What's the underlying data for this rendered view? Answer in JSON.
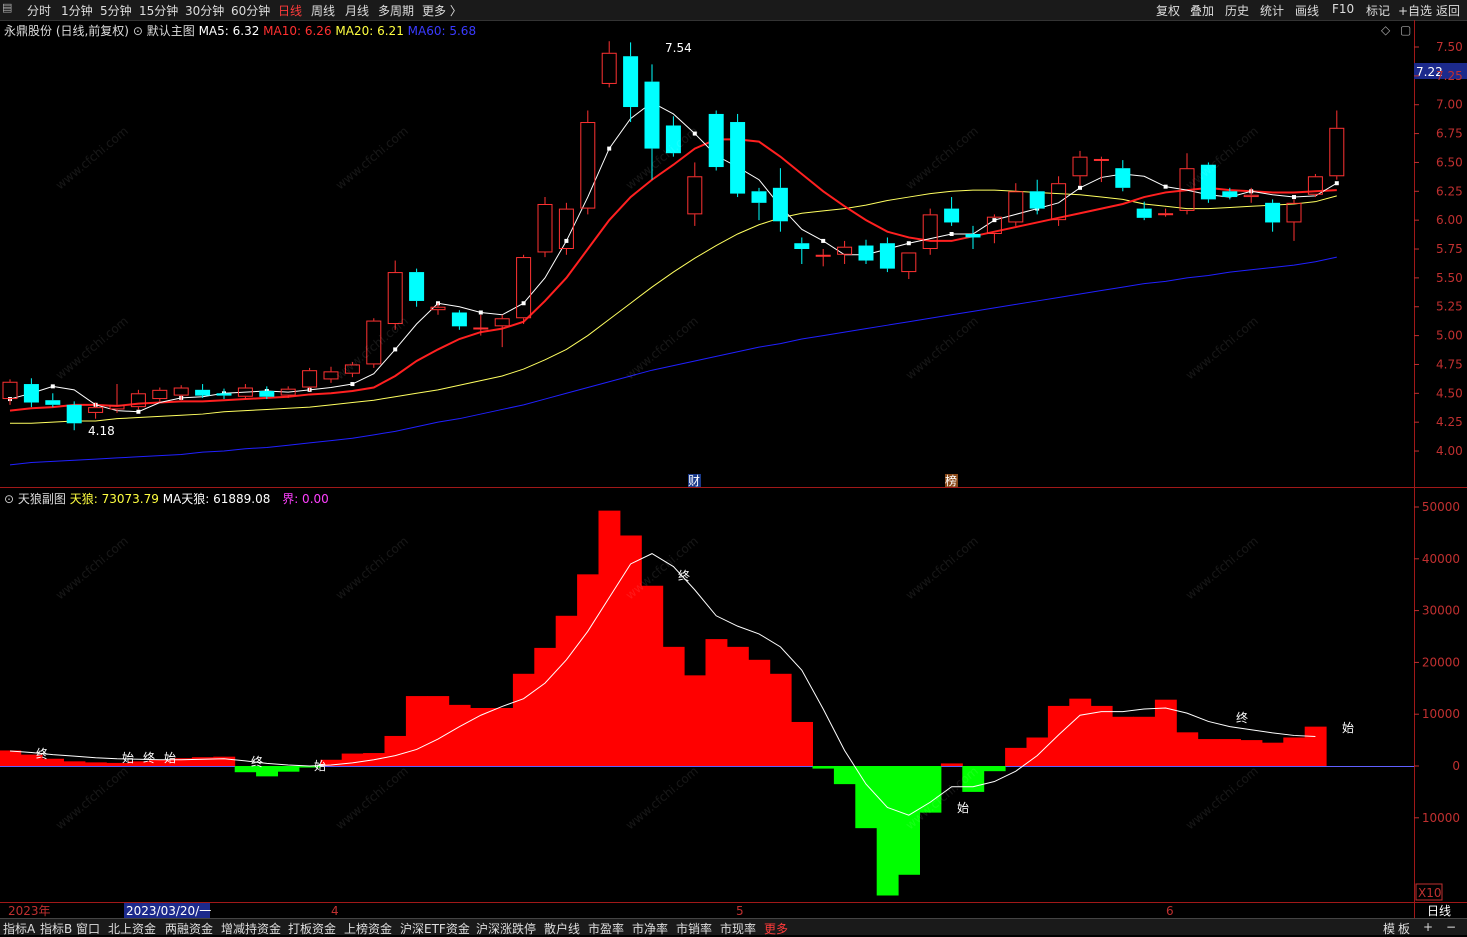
{
  "toolbar": {
    "left": [
      "分时",
      "1分钟",
      "5分钟",
      "15分钟",
      "30分钟",
      "60分钟",
      "日线",
      "周线",
      "月线",
      "多周期",
      "更多 〉"
    ],
    "active": "日线",
    "right": [
      "复权",
      "叠加",
      "历史",
      "统计",
      "画线",
      "F10",
      "标记",
      "+自选",
      "返回"
    ]
  },
  "main_legend": {
    "stock": "永鼎股份 (日线,前复权)",
    "template": "默认主图",
    "ma5": "MA5: 6.32",
    "ma10": "MA10: 6.26",
    "ma20": "MA20: 6.21",
    "ma60": "MA60: 5.68"
  },
  "sub_legend": {
    "name": "天狼副图",
    "tianlang": "天狼: 73073.79",
    "ma_tianlang": "MA天狼: 61889.08",
    "jie": "界: 0.00"
  },
  "colors": {
    "up": "#ff3232",
    "down": "#00ffff",
    "ma5": "#ffffff",
    "ma10": "#ff2020",
    "ma20": "#ffff60",
    "ma60": "#2020ff",
    "pos": "#ff0000",
    "neg": "#00ff00"
  },
  "price_axis": [
    "7.50",
    "7.25",
    "7.00",
    "6.75",
    "6.50",
    "6.25",
    "6.00",
    "5.75",
    "5.50",
    "5.25",
    "5.00",
    "4.75",
    "4.50",
    "4.25",
    "4.00"
  ],
  "current_price": "7.22",
  "annotations": {
    "high": "7.54",
    "low": "4.18",
    "cai": "财",
    "bang": "榜"
  },
  "sub_axis": [
    "50000",
    "40000",
    "30000",
    "20000",
    "10000",
    "0",
    "10000"
  ],
  "sub_labels": [
    "终",
    "始",
    "终",
    "始",
    "终",
    "始",
    "终",
    "始",
    "终",
    "始"
  ],
  "x10": "X10",
  "date_axis": {
    "year": "2023年",
    "date": "2023/03/20/一",
    "months": [
      "4",
      "5",
      "6"
    ],
    "period": "日线"
  },
  "bottom_tabs": [
    "指标A",
    "指标B",
    "窗口",
    "北上资金",
    "两融资金",
    "增减持资金",
    "打板资金",
    "上榜资金",
    "沪深ETF资金",
    "沪深涨跌停",
    "散户线",
    "市盈率",
    "市净率",
    "市销率",
    "市现率",
    "更多"
  ],
  "bottom_right": [
    "模",
    "板",
    "+",
    "−"
  ],
  "watermark": "www.cfchi.com",
  "chart_data": [
    {
      "type": "candlestick",
      "title": "永鼎股份 (日线,前复权)",
      "ylim": [
        3.85,
        7.6
      ],
      "candles": [
        {
          "o": 4.45,
          "h": 4.62,
          "l": 4.4,
          "c": 4.6
        },
        {
          "o": 4.58,
          "h": 4.63,
          "l": 4.38,
          "c": 4.42
        },
        {
          "o": 4.44,
          "h": 4.5,
          "l": 4.38,
          "c": 4.4
        },
        {
          "o": 4.4,
          "h": 4.43,
          "l": 4.18,
          "c": 4.24
        },
        {
          "o": 4.33,
          "h": 4.42,
          "l": 4.28,
          "c": 4.38
        },
        {
          "o": 4.36,
          "h": 4.58,
          "l": 4.33,
          "c": 4.4
        },
        {
          "o": 4.38,
          "h": 4.53,
          "l": 4.36,
          "c": 4.5
        },
        {
          "o": 4.45,
          "h": 4.55,
          "l": 4.42,
          "c": 4.53
        },
        {
          "o": 4.48,
          "h": 4.57,
          "l": 4.44,
          "c": 4.55
        },
        {
          "o": 4.53,
          "h": 4.58,
          "l": 4.46,
          "c": 4.48
        },
        {
          "o": 4.5,
          "h": 4.54,
          "l": 4.45,
          "c": 4.48
        },
        {
          "o": 4.47,
          "h": 4.58,
          "l": 4.45,
          "c": 4.55
        },
        {
          "o": 4.52,
          "h": 4.56,
          "l": 4.45,
          "c": 4.47
        },
        {
          "o": 4.48,
          "h": 4.56,
          "l": 4.46,
          "c": 4.54
        },
        {
          "o": 4.55,
          "h": 4.72,
          "l": 4.52,
          "c": 4.7
        },
        {
          "o": 4.62,
          "h": 4.73,
          "l": 4.59,
          "c": 4.69
        },
        {
          "o": 4.67,
          "h": 4.77,
          "l": 4.64,
          "c": 4.75
        },
        {
          "o": 4.75,
          "h": 5.15,
          "l": 4.72,
          "c": 5.13
        },
        {
          "o": 5.1,
          "h": 5.65,
          "l": 5.05,
          "c": 5.55
        },
        {
          "o": 5.55,
          "h": 5.58,
          "l": 5.25,
          "c": 5.3
        },
        {
          "o": 5.22,
          "h": 5.28,
          "l": 5.18,
          "c": 5.25
        },
        {
          "o": 5.2,
          "h": 5.22,
          "l": 5.05,
          "c": 5.08
        },
        {
          "o": 5.06,
          "h": 5.18,
          "l": 5.0,
          "c": 5.07
        },
        {
          "o": 5.08,
          "h": 5.18,
          "l": 4.9,
          "c": 5.15
        },
        {
          "o": 5.15,
          "h": 5.7,
          "l": 5.1,
          "c": 5.68
        },
        {
          "o": 5.72,
          "h": 6.2,
          "l": 5.68,
          "c": 6.14
        },
        {
          "o": 5.75,
          "h": 6.15,
          "l": 5.7,
          "c": 6.1
        },
        {
          "o": 6.1,
          "h": 6.95,
          "l": 6.05,
          "c": 6.85
        },
        {
          "o": 7.18,
          "h": 7.55,
          "l": 7.15,
          "c": 7.45
        },
        {
          "o": 7.42,
          "h": 7.54,
          "l": 6.85,
          "c": 6.98
        },
        {
          "o": 7.2,
          "h": 7.35,
          "l": 6.35,
          "c": 6.62
        },
        {
          "o": 6.82,
          "h": 6.9,
          "l": 6.55,
          "c": 6.58
        },
        {
          "o": 6.05,
          "h": 6.5,
          "l": 5.95,
          "c": 6.38
        },
        {
          "o": 6.92,
          "h": 6.95,
          "l": 6.43,
          "c": 6.46
        },
        {
          "o": 6.85,
          "h": 6.92,
          "l": 6.2,
          "c": 6.23
        },
        {
          "o": 6.25,
          "h": 6.28,
          "l": 6.0,
          "c": 6.15
        },
        {
          "o": 6.28,
          "h": 6.45,
          "l": 5.9,
          "c": 5.99
        },
        {
          "o": 5.8,
          "h": 5.85,
          "l": 5.62,
          "c": 5.75
        },
        {
          "o": 5.7,
          "h": 5.75,
          "l": 5.6,
          "c": 5.7
        },
        {
          "o": 5.7,
          "h": 5.82,
          "l": 5.62,
          "c": 5.77
        },
        {
          "o": 5.78,
          "h": 5.83,
          "l": 5.62,
          "c": 5.65
        },
        {
          "o": 5.8,
          "h": 5.85,
          "l": 5.55,
          "c": 5.58
        },
        {
          "o": 5.55,
          "h": 5.72,
          "l": 5.49,
          "c": 5.72
        },
        {
          "o": 5.75,
          "h": 6.1,
          "l": 5.7,
          "c": 6.05
        },
        {
          "o": 6.1,
          "h": 6.2,
          "l": 5.95,
          "c": 5.98
        },
        {
          "o": 5.88,
          "h": 5.95,
          "l": 5.75,
          "c": 5.85
        },
        {
          "o": 5.88,
          "h": 6.05,
          "l": 5.8,
          "c": 6.03
        },
        {
          "o": 5.98,
          "h": 6.32,
          "l": 5.95,
          "c": 6.25
        },
        {
          "o": 6.25,
          "h": 6.35,
          "l": 6.05,
          "c": 6.1
        },
        {
          "o": 6.0,
          "h": 6.38,
          "l": 5.95,
          "c": 6.32
        },
        {
          "o": 6.38,
          "h": 6.6,
          "l": 6.3,
          "c": 6.55
        },
        {
          "o": 6.52,
          "h": 6.55,
          "l": 6.33,
          "c": 6.53
        },
        {
          "o": 6.45,
          "h": 6.52,
          "l": 6.25,
          "c": 6.28
        },
        {
          "o": 6.1,
          "h": 6.16,
          "l": 6.0,
          "c": 6.02
        },
        {
          "o": 6.05,
          "h": 6.1,
          "l": 6.03,
          "c": 6.06
        },
        {
          "o": 6.08,
          "h": 6.58,
          "l": 6.05,
          "c": 6.45
        },
        {
          "o": 6.48,
          "h": 6.5,
          "l": 6.15,
          "c": 6.18
        },
        {
          "o": 6.25,
          "h": 6.28,
          "l": 6.18,
          "c": 6.2
        },
        {
          "o": 6.2,
          "h": 6.28,
          "l": 6.15,
          "c": 6.22
        },
        {
          "o": 6.15,
          "h": 6.18,
          "l": 5.9,
          "c": 5.98
        },
        {
          "o": 5.98,
          "h": 6.18,
          "l": 5.82,
          "c": 6.15
        },
        {
          "o": 6.22,
          "h": 6.4,
          "l": 6.2,
          "c": 6.38
        },
        {
          "o": 6.38,
          "h": 6.95,
          "l": 6.35,
          "c": 6.8
        }
      ],
      "ma": {
        "ma5": [
          4.45,
          4.5,
          4.56,
          4.53,
          4.4,
          4.35,
          4.34,
          4.42,
          4.46,
          4.47,
          4.5,
          4.51,
          4.52,
          4.51,
          4.53,
          4.55,
          4.58,
          4.67,
          4.88,
          5.1,
          5.28,
          5.25,
          5.2,
          5.18,
          5.28,
          5.5,
          5.82,
          6.2,
          6.62,
          6.88,
          7.02,
          6.92,
          6.75,
          6.56,
          6.46,
          6.35,
          6.12,
          5.92,
          5.82,
          5.7,
          5.7,
          5.75,
          5.8,
          5.84,
          5.88,
          5.88,
          6.0,
          6.05,
          6.1,
          6.15,
          6.28,
          6.37,
          6.4,
          6.38,
          6.29,
          6.26,
          6.22,
          6.2,
          6.25,
          6.22,
          6.2,
          6.21,
          6.32
        ],
        "ma10": [
          4.35,
          4.37,
          4.38,
          4.4,
          4.4,
          4.39,
          4.41,
          4.42,
          4.43,
          4.43,
          4.44,
          4.45,
          4.46,
          4.47,
          4.49,
          4.5,
          4.52,
          4.55,
          4.65,
          4.78,
          4.88,
          4.97,
          5.03,
          5.06,
          5.12,
          5.3,
          5.5,
          5.75,
          6.0,
          6.2,
          6.35,
          6.48,
          6.62,
          6.7,
          6.7,
          6.68,
          6.55,
          6.4,
          6.25,
          6.12,
          6.0,
          5.9,
          5.85,
          5.82,
          5.82,
          5.86,
          5.9,
          5.94,
          5.98,
          6.02,
          6.06,
          6.1,
          6.14,
          6.2,
          6.24,
          6.26,
          6.28,
          6.26,
          6.25,
          6.24,
          6.24,
          6.25,
          6.26
        ],
        "ma20": [
          4.24,
          4.24,
          4.25,
          4.26,
          4.26,
          4.28,
          4.29,
          4.3,
          4.31,
          4.32,
          4.34,
          4.35,
          4.36,
          4.37,
          4.38,
          4.4,
          4.42,
          4.44,
          4.47,
          4.5,
          4.53,
          4.57,
          4.61,
          4.65,
          4.71,
          4.79,
          4.88,
          5.0,
          5.14,
          5.28,
          5.42,
          5.55,
          5.67,
          5.78,
          5.88,
          5.96,
          6.02,
          6.06,
          6.08,
          6.1,
          6.13,
          6.17,
          6.2,
          6.23,
          6.25,
          6.26,
          6.26,
          6.25,
          6.24,
          6.23,
          6.22,
          6.2,
          6.18,
          6.14,
          6.12,
          6.1,
          6.1,
          6.11,
          6.12,
          6.13,
          6.14,
          6.16,
          6.21
        ],
        "ma60": [
          3.88,
          3.9,
          3.91,
          3.92,
          3.93,
          3.94,
          3.95,
          3.96,
          3.97,
          3.99,
          4.0,
          4.02,
          4.03,
          4.05,
          4.07,
          4.09,
          4.11,
          4.14,
          4.17,
          4.21,
          4.25,
          4.28,
          4.32,
          4.36,
          4.4,
          4.45,
          4.5,
          4.55,
          4.6,
          4.65,
          4.7,
          4.74,
          4.78,
          4.82,
          4.86,
          4.9,
          4.93,
          4.97,
          5.0,
          5.03,
          5.06,
          5.09,
          5.12,
          5.15,
          5.18,
          5.21,
          5.24,
          5.27,
          5.3,
          5.33,
          5.36,
          5.39,
          5.42,
          5.45,
          5.47,
          5.5,
          5.52,
          5.55,
          5.57,
          5.59,
          5.61,
          5.64,
          5.68
        ]
      }
    },
    {
      "type": "bar",
      "title": "天狼副图",
      "ylim": [
        -25000,
        50000
      ],
      "series": [
        {
          "name": "天狼",
          "values": [
            3000,
            2200,
            1400,
            900,
            700,
            600,
            900,
            1200,
            1500,
            1700,
            1800,
            -1200,
            -2000,
            -1100,
            -300,
            1200,
            2400,
            2500,
            5800,
            13500,
            13500,
            11800,
            11200,
            11200,
            17800,
            22800,
            29000,
            37000,
            49300,
            44500,
            34800,
            23000,
            17500,
            24500,
            23000,
            20500,
            17800,
            8500,
            -500,
            -3500,
            -12000,
            -25000,
            -21000,
            -9000,
            500,
            -5000,
            -1000,
            3500,
            5500,
            11600,
            13000,
            11600,
            9500,
            9500,
            12800,
            6500,
            5200,
            5200,
            5000,
            4500,
            5500,
            7600
          ]
        },
        {
          "name": "MA天狼",
          "values": [
            2900,
            2600,
            2200,
            1900,
            1600,
            1400,
            1300,
            1200,
            1200,
            1300,
            1400,
            1000,
            500,
            200,
            0,
            200,
            600,
            1200,
            2000,
            3200,
            5200,
            7600,
            9800,
            11500,
            13000,
            16000,
            20500,
            26000,
            32500,
            39000,
            41000,
            38500,
            34000,
            29000,
            27000,
            25500,
            23000,
            18500,
            11000,
            3000,
            -3500,
            -8000,
            -9500,
            -7000,
            -4000,
            -4000,
            -3000,
            -1000,
            2000,
            6000,
            9800,
            10500,
            10500,
            11000,
            11200,
            10200,
            8600,
            7600,
            7000,
            6400,
            5900,
            5700
          ]
        }
      ]
    }
  ]
}
